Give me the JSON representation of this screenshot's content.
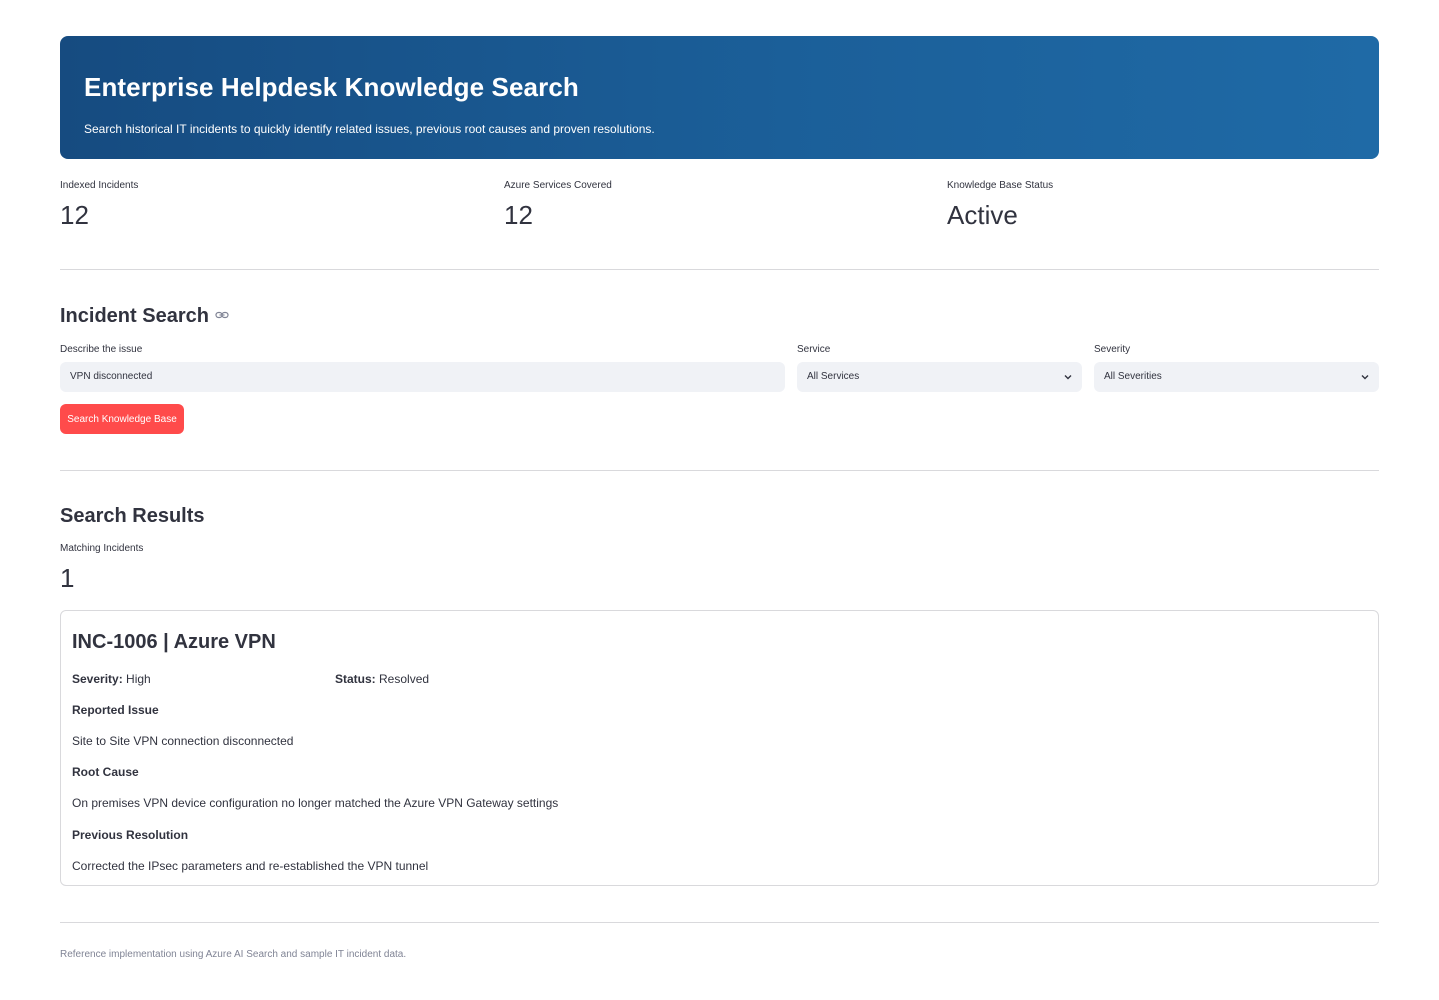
{
  "banner": {
    "title": "Enterprise Helpdesk Knowledge Search",
    "subtitle": "Search historical IT incidents to quickly identify related issues, previous root causes and proven resolutions."
  },
  "metrics": [
    {
      "label": "Indexed Incidents",
      "value": "12"
    },
    {
      "label": "Azure Services Covered",
      "value": "12"
    },
    {
      "label": "Knowledge Base Status",
      "value": "Active"
    }
  ],
  "search": {
    "title": "Incident Search",
    "issue_label": "Describe the issue",
    "issue_value": "VPN disconnected",
    "service_label": "Service",
    "service_value": "All Services",
    "severity_label": "Severity",
    "severity_value": "All Severities",
    "button_label": "Search Knowledge Base"
  },
  "results": {
    "title": "Search Results",
    "matching_label": "Matching Incidents",
    "matching_value": "1",
    "incident": {
      "title": "INC-1006 | Azure VPN",
      "severity_label": "Severity:",
      "severity_value": "High",
      "status_label": "Status:",
      "status_value": "Resolved",
      "reported_issue_heading": "Reported Issue",
      "reported_issue": "Site to Site VPN connection disconnected",
      "root_cause_heading": "Root Cause",
      "root_cause": "On premises VPN device configuration no longer matched the Azure VPN Gateway settings",
      "resolution_heading": "Previous Resolution",
      "resolution": "Corrected the IPsec parameters and re-established the VPN tunnel"
    }
  },
  "footer": "Reference implementation using Azure AI Search and sample IT incident data.",
  "colors": {
    "banner_start": "#164b80",
    "banner_end": "#1f6aa6",
    "button": "#ff4b4b",
    "input_bg": "#f0f2f6"
  },
  "icons": {
    "section_link": "link-icon",
    "dropdown": "chevron-down-icon"
  }
}
